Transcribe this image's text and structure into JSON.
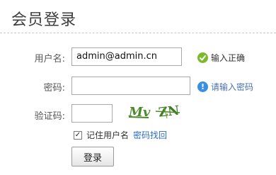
{
  "page": {
    "title": "会员登录"
  },
  "form": {
    "username": {
      "label": "用户名:",
      "value": "admin@admin.cn",
      "status_text": "输入正确"
    },
    "password": {
      "label": "密码:",
      "value": "",
      "status_text": "请输入密码"
    },
    "captcha": {
      "label": "验证码:",
      "value": "",
      "image_text": "Mv ZN"
    },
    "remember": {
      "label": "记住用户名",
      "checked": true
    },
    "recover_link": "密码找回",
    "submit_label": "登录"
  },
  "colors": {
    "ok": "#7cb92c",
    "info": "#3b8fe0",
    "captcha_text": "#4a8a2a"
  }
}
